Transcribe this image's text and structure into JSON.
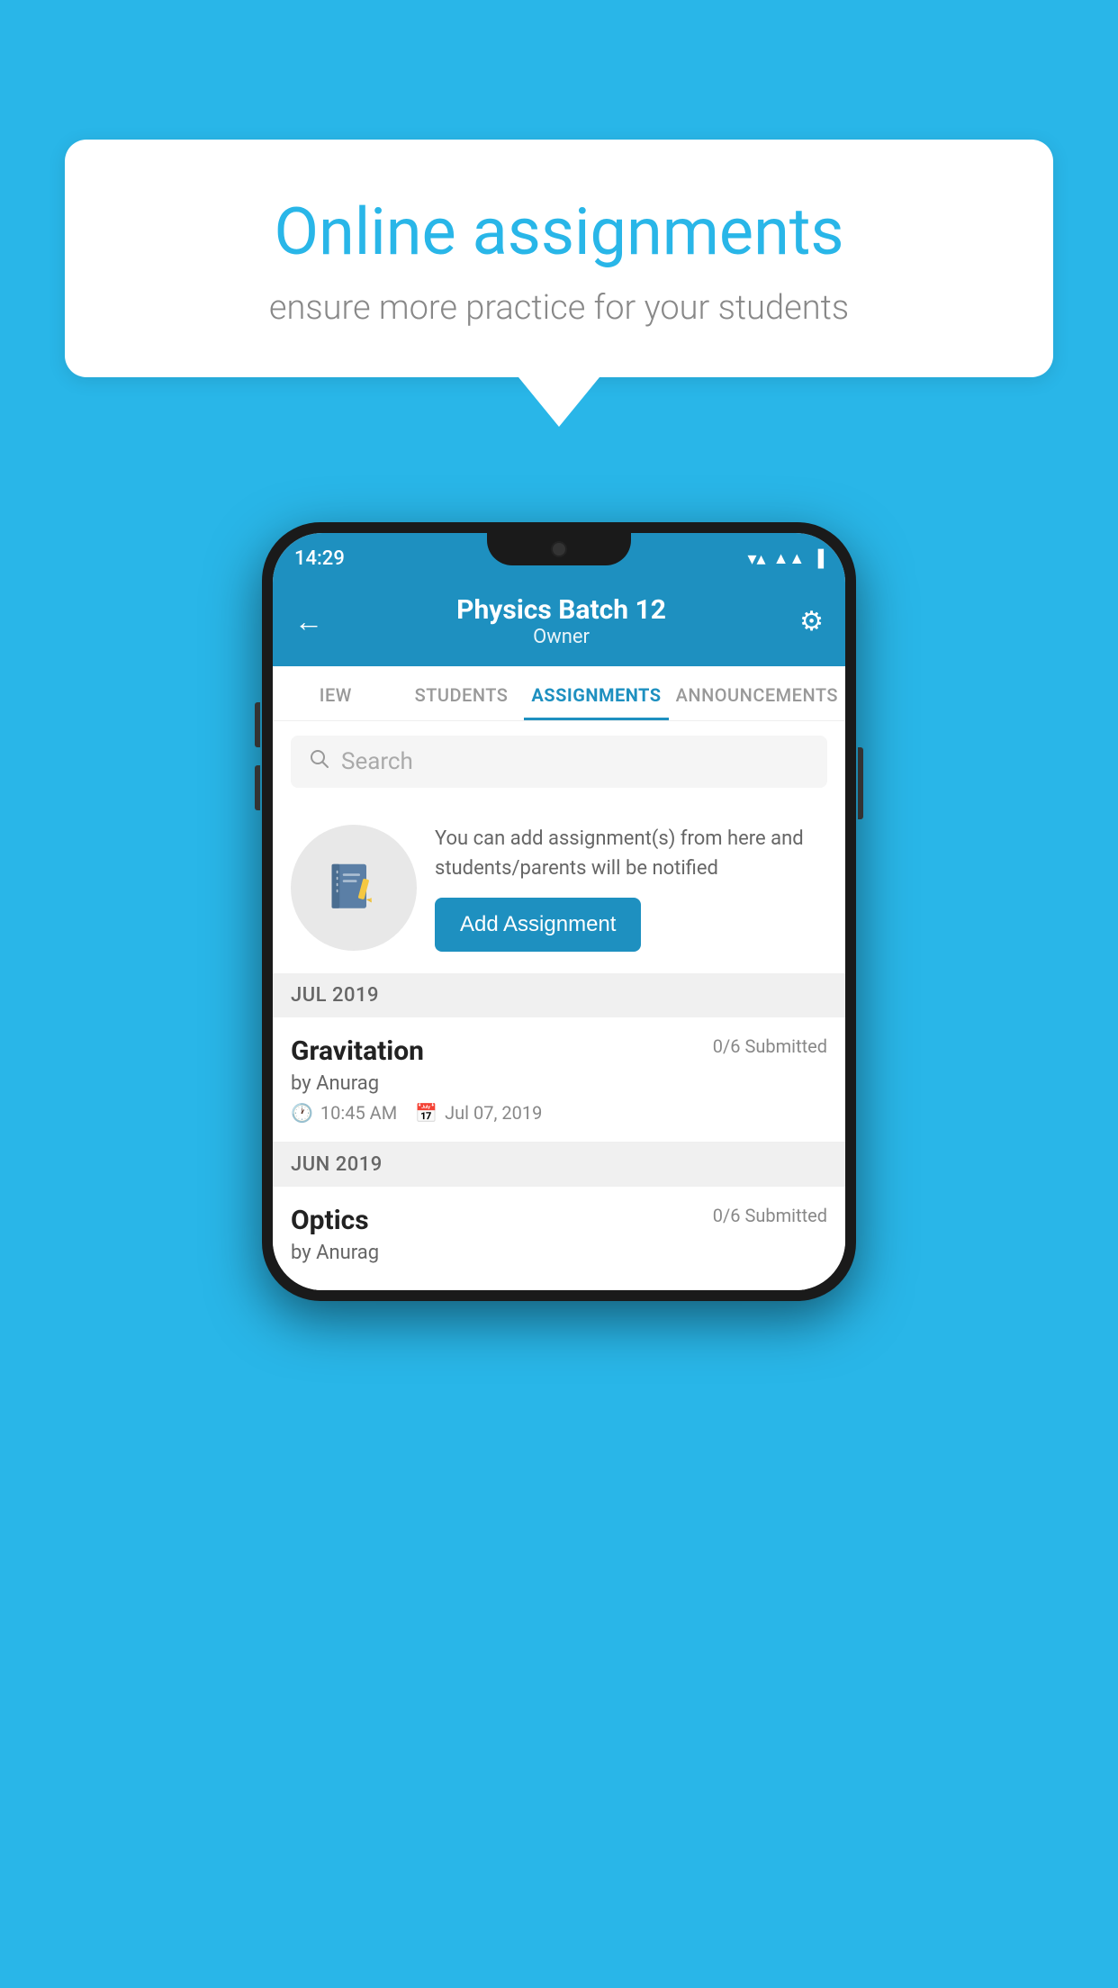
{
  "background_color": "#29b6e8",
  "speech_bubble": {
    "title": "Online assignments",
    "subtitle": "ensure more practice for your students"
  },
  "phone": {
    "status_bar": {
      "time": "14:29",
      "wifi_icon": "wifi",
      "signal_icon": "signal",
      "battery_icon": "battery"
    },
    "header": {
      "title": "Physics Batch 12",
      "subtitle": "Owner",
      "back_label": "←",
      "settings_label": "⚙"
    },
    "tabs": [
      {
        "label": "IEW",
        "active": false
      },
      {
        "label": "STUDENTS",
        "active": false
      },
      {
        "label": "ASSIGNMENTS",
        "active": true
      },
      {
        "label": "ANNOUNCEMENTS",
        "active": false
      }
    ],
    "search": {
      "placeholder": "Search"
    },
    "promo": {
      "text": "You can add assignment(s) from here and students/parents will be notified",
      "button_label": "Add Assignment"
    },
    "assignments": [
      {
        "month": "JUL 2019",
        "items": [
          {
            "name": "Gravitation",
            "submitted": "0/6 Submitted",
            "by": "by Anurag",
            "time": "10:45 AM",
            "date": "Jul 07, 2019"
          }
        ]
      },
      {
        "month": "JUN 2019",
        "items": [
          {
            "name": "Optics",
            "submitted": "0/6 Submitted",
            "by": "by Anurag",
            "time": "",
            "date": ""
          }
        ]
      }
    ]
  }
}
